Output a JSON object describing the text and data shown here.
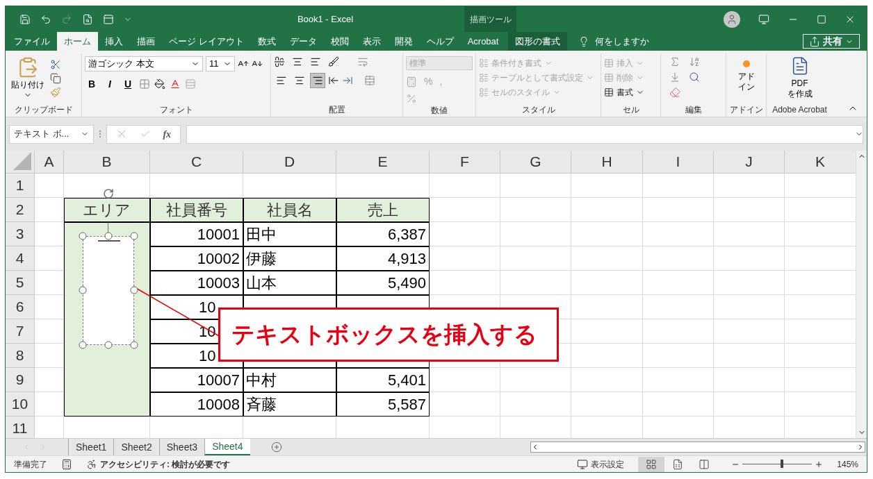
{
  "title_bar": {
    "title": "Book1  -  Excel",
    "context_label": "描画ツール"
  },
  "menu_tabs": [
    {
      "label": "ファイル",
      "selected": false,
      "kind": "normal"
    },
    {
      "label": "ホーム",
      "selected": true,
      "kind": "normal"
    },
    {
      "label": "挿入",
      "selected": false,
      "kind": "normal"
    },
    {
      "label": "描画",
      "selected": false,
      "kind": "normal"
    },
    {
      "label": "ページ レイアウト",
      "selected": false,
      "kind": "normal"
    },
    {
      "label": "数式",
      "selected": false,
      "kind": "normal"
    },
    {
      "label": "データ",
      "selected": false,
      "kind": "normal"
    },
    {
      "label": "校閲",
      "selected": false,
      "kind": "normal"
    },
    {
      "label": "表示",
      "selected": false,
      "kind": "normal"
    },
    {
      "label": "開発",
      "selected": false,
      "kind": "normal"
    },
    {
      "label": "ヘルプ",
      "selected": false,
      "kind": "normal"
    },
    {
      "label": "Acrobat",
      "selected": false,
      "kind": "normal"
    },
    {
      "label": "図形の書式",
      "selected": false,
      "kind": "context"
    }
  ],
  "tell_me": "何をしますか",
  "share_button": "共有",
  "ribbon": {
    "clipboard": {
      "paste": "貼り付け",
      "label": "クリップボード"
    },
    "font": {
      "name": "游ゴシック 本文",
      "size": "11",
      "style_buttons": [
        "B",
        "I",
        "U"
      ],
      "label": "フォント"
    },
    "alignment": {
      "buttons": [
        {
          "kind": "left",
          "selected": false
        },
        {
          "kind": "center",
          "selected": false
        },
        {
          "kind": "right",
          "selected": true
        }
      ],
      "label": "配置"
    },
    "number": {
      "format": "標準",
      "symbols": [
        "%",
        ","
      ],
      "disabled": true,
      "label": "数値"
    },
    "styles": {
      "items": [
        "条件付き書式",
        "テーブルとして書式設定",
        "セルのスタイル"
      ],
      "disabled": true,
      "label": "スタイル"
    },
    "cells": {
      "items": [
        {
          "label": "挿入",
          "disabled": true
        },
        {
          "label": "削除",
          "disabled": true
        },
        {
          "label": "書式",
          "disabled": false
        }
      ],
      "label": "セル"
    },
    "editing": {
      "label": "編集"
    },
    "addin": {
      "lines": [
        "アド",
        "イン"
      ],
      "label": "アドイン"
    },
    "acrobat": {
      "lines": [
        "PDF",
        "を作成"
      ],
      "label": "Adobe Acrobat"
    }
  },
  "formula_bar": {
    "name_box": "テキスト ボ...",
    "fx": "fx"
  },
  "columns": [
    "A",
    "B",
    "C",
    "D",
    "E",
    "F",
    "G",
    "H",
    "I",
    "J",
    "K"
  ],
  "rows": [
    "1",
    "2",
    "3",
    "4",
    "5",
    "6",
    "7",
    "8",
    "9",
    "10",
    "11"
  ],
  "table": {
    "headers": [
      "エリア",
      "社員番号",
      "社員名",
      "売上"
    ],
    "records": [
      {
        "kind": "full",
        "id": "10001",
        "name": "田中",
        "sales": "6,387"
      },
      {
        "kind": "full",
        "id": "10002",
        "name": "伊藤",
        "sales": "4,913"
      },
      {
        "kind": "full",
        "id": "10003",
        "name": "山本",
        "sales": "5,490"
      },
      {
        "kind": "covered",
        "id": "10"
      },
      {
        "kind": "covered",
        "id": "10"
      },
      {
        "kind": "covered",
        "id": "10"
      },
      {
        "kind": "full",
        "id": "10007",
        "name": "中村",
        "sales": "5,401"
      },
      {
        "kind": "full",
        "id": "10008",
        "name": "斉藤",
        "sales": "5,587"
      }
    ]
  },
  "callout": "テキストボックスを挿入する",
  "sheet_tabs": [
    {
      "label": "Sheet1",
      "selected": false
    },
    {
      "label": "Sheet2",
      "selected": false
    },
    {
      "label": "Sheet3",
      "selected": false
    },
    {
      "label": "Sheet4",
      "selected": true
    }
  ],
  "status_bar": {
    "ready": "準備完了",
    "accessibility": "アクセシビリティ: 検討が必要です",
    "display_settings": "表示設定",
    "views": [
      {
        "kind": "normal",
        "selected": true
      },
      {
        "kind": "page_layout",
        "selected": false
      },
      {
        "kind": "page_break",
        "selected": false
      }
    ],
    "zoom_slider": {
      "level": 0.57
    },
    "zoom": "145%"
  }
}
